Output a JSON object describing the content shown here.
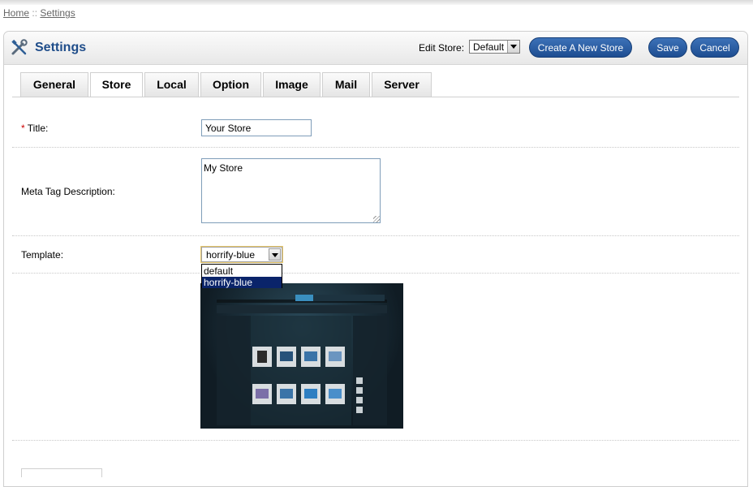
{
  "breadcrumb": {
    "home": "Home",
    "separator": "::",
    "current": "Settings"
  },
  "header": {
    "icon": "tools-icon",
    "title": "Settings",
    "edit_store_label": "Edit Store:",
    "edit_store_value": "Default",
    "create_button": "Create A New Store",
    "save_button": "Save",
    "cancel_button": "Cancel",
    "accent_color": "#1f4d8a"
  },
  "tabs": [
    {
      "label": "General"
    },
    {
      "label": "Store",
      "active": true
    },
    {
      "label": "Local"
    },
    {
      "label": "Option"
    },
    {
      "label": "Image"
    },
    {
      "label": "Mail"
    },
    {
      "label": "Server"
    }
  ],
  "form": {
    "title": {
      "required_mark": "*",
      "label": "Title:",
      "value": "Your Store"
    },
    "meta_description": {
      "label": "Meta Tag Description:",
      "value": "My Store"
    },
    "template": {
      "label": "Template:",
      "value": "horrify-blue",
      "options": [
        "default",
        "horrify-blue"
      ],
      "preview_image": "template-preview-image"
    }
  }
}
